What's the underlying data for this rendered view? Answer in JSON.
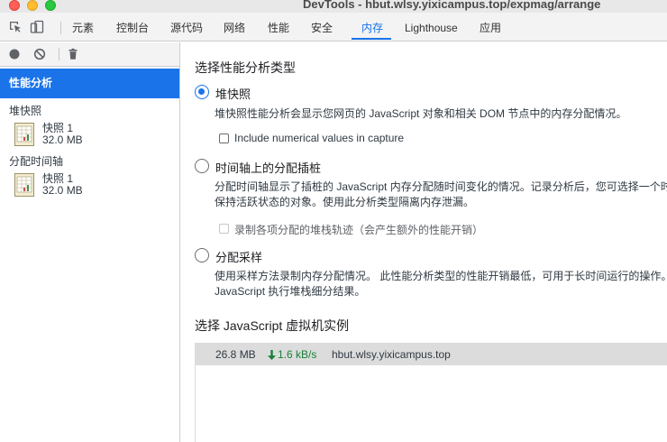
{
  "window": {
    "title": "DevTools - hbut.wlsy.yixicampus.top/expmag/arrange"
  },
  "tabs": [
    {
      "label": "元素"
    },
    {
      "label": "控制台"
    },
    {
      "label": "源代码"
    },
    {
      "label": "网络"
    },
    {
      "label": "性能"
    },
    {
      "label": "安全"
    },
    {
      "label": "内存",
      "active": true
    },
    {
      "label": "Lighthouse"
    },
    {
      "label": "应用"
    }
  ],
  "toolbar_icons": [
    "inspect-icon",
    "device-toggle-icon"
  ],
  "sidebar": {
    "tools": [
      "record-icon",
      "clear-icon",
      "trash-icon"
    ],
    "selected": "性能分析",
    "groups": [
      {
        "title": "堆快照",
        "snapshot": {
          "name": "快照 1",
          "size": "32.0 MB"
        }
      },
      {
        "title": "分配时间轴",
        "snapshot": {
          "name": "快照 1",
          "size": "32.0 MB"
        }
      }
    ]
  },
  "main": {
    "profile_type_heading": "选择性能分析类型",
    "options": [
      {
        "label": "堆快照",
        "checked": true,
        "desc": [
          "堆快照性能分析会显示您网页的 JavaScript 对象和相关 DOM 节点中的内存分配情况。"
        ],
        "checkbox": {
          "label": "Include numerical values in capture",
          "checked": false,
          "disabled": false
        }
      },
      {
        "label": "时间轴上的分配插桩",
        "checked": false,
        "desc": [
          "分配时间轴显示了插桩的 JavaScript 内存分配随时间变化的情况。记录分析后，您可选择一个时间",
          "保持活跃状态的对象。使用此分析类型隔离内存泄漏。"
        ],
        "checkbox": {
          "label": "录制各项分配的堆栈轨迹（会产生额外的性能开销）",
          "checked": false,
          "disabled": true
        }
      },
      {
        "label": "分配采样",
        "checked": false,
        "desc": [
          "使用采样方法录制内存分配情况。 此性能分析类型的性能开销最低，可用于长时间运行的操作。",
          "JavaScript 执行堆栈细分结果。"
        ]
      }
    ],
    "vm_heading": "选择 JavaScript 虚拟机实例",
    "vm_instances": [
      {
        "size": "26.8 MB",
        "rate": "1.6 kB/s",
        "host": "hbut.wlsy.yixicampus.top"
      }
    ]
  },
  "colors": {
    "accent": "#1a73e8",
    "rate_green": "#188038"
  }
}
